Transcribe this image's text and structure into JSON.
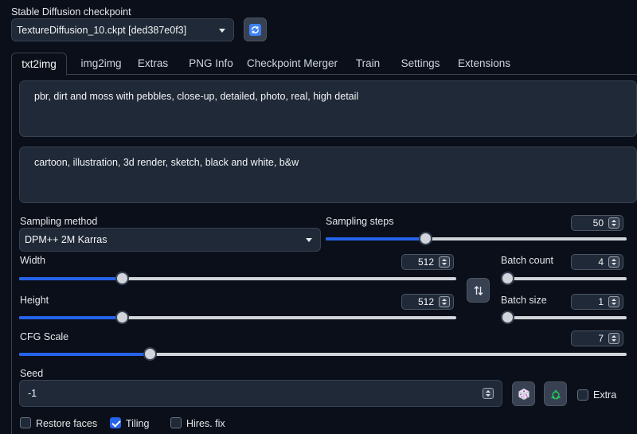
{
  "checkpoint": {
    "label": "Stable Diffusion checkpoint",
    "value": "TextureDiffusion_10.ckpt [ded387e0f3]",
    "refresh_icon": "refresh-icon"
  },
  "tabs": [
    {
      "label": "txt2img",
      "active": true
    },
    {
      "label": "img2img"
    },
    {
      "label": "Extras"
    },
    {
      "label": "PNG Info"
    },
    {
      "label": "Checkpoint Merger"
    },
    {
      "label": "Train"
    },
    {
      "label": "Settings"
    },
    {
      "label": "Extensions"
    }
  ],
  "prompt": {
    "value": "pbr, dirt and moss with pebbles, close-up,  detailed, photo, real, high detail"
  },
  "negative_prompt": {
    "value": "cartoon, illustration, 3d render, sketch, black and white, b&w"
  },
  "sampling_method": {
    "label": "Sampling method",
    "value": "DPM++ 2M Karras"
  },
  "sampling_steps": {
    "label": "Sampling steps",
    "value": "50",
    "fraction": 0.33
  },
  "width": {
    "label": "Width",
    "value": "512",
    "fraction": 0.235
  },
  "height": {
    "label": "Height",
    "value": "512",
    "fraction": 0.235
  },
  "swap_icon": "swap-arrows-icon",
  "batch_count": {
    "label": "Batch count",
    "value": "4",
    "fraction": 0.03
  },
  "batch_size": {
    "label": "Batch size",
    "value": "1",
    "fraction": 0.0
  },
  "cfg_scale": {
    "label": "CFG Scale",
    "value": "7",
    "fraction": 0.215
  },
  "seed": {
    "label": "Seed",
    "value": "-1",
    "dice_icon": "dice-icon",
    "recycle_icon": "recycle-icon"
  },
  "extra": {
    "label": "Extra",
    "checked": false
  },
  "options": {
    "restore_faces": {
      "label": "Restore faces",
      "checked": false
    },
    "tiling": {
      "label": "Tiling",
      "checked": true
    },
    "hires_fix": {
      "label": "Hires. fix",
      "checked": false
    }
  },
  "colors": {
    "accent": "#2563eb",
    "background": "#0b0f19",
    "panel": "#1f2937",
    "recycle": "#22c55e"
  }
}
